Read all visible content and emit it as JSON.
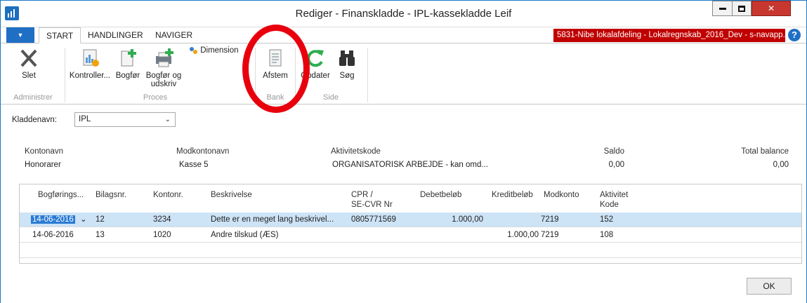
{
  "window": {
    "title": "Rediger - Finanskladde - IPL-kassekladde Leif"
  },
  "tabs": [
    {
      "label": "START"
    },
    {
      "label": "HANDLINGER"
    },
    {
      "label": "NAVIGER"
    }
  ],
  "company": "5831-Nibe lokalafdeling - Lokalregnskab_2016_Dev - s-navapp...",
  "help_label": "?",
  "ribbon": {
    "slet": "Slet",
    "kontroller": "Kontroller...",
    "bogfor": "Bogfør",
    "bogfor_udskriv_1": "Bogfør og",
    "bogfor_udskriv_2": "udskriv",
    "dimensioner": "Dimension",
    "afstem": "Afstem",
    "opdater": "Opdater",
    "sog": "Søg",
    "group_administrer": "Administrer",
    "group_proces": "Proces",
    "group_bank": "Bank",
    "group_side": "Side"
  },
  "kladde": {
    "label": "Kladdenavn:",
    "value": "IPL"
  },
  "info": {
    "kontonavn_label": "Kontonavn",
    "kontonavn_value": "Honorarer",
    "modkontonavn_label": "Modkontonavn",
    "modkontonavn_value": "Kasse 5",
    "aktivitetskode_label": "Aktivitetskode",
    "aktivitetskode_value": "ORGANISATORISK ARBEJDE - kan omd...",
    "saldo_label": "Saldo",
    "saldo_value": "0,00",
    "total_label": "Total balance",
    "total_value": "0,00"
  },
  "grid": {
    "headers": {
      "bogforing": "Bogførings...",
      "bilagsnr": "Bilagsnr.",
      "kontonr": "Kontonr.",
      "beskrivelse": "Beskrivelse",
      "cpr_1": "CPR /",
      "cpr_2": "SE-CVR Nr",
      "debet": "Debetbeløb",
      "kredit": "Kreditbeløb",
      "modkonto": "Modkonto",
      "aktivitet_1": "Aktivitet",
      "aktivitet_2": "Kode"
    },
    "rows": [
      {
        "date": "14-06-2016",
        "bilag": "12",
        "konto": "3234",
        "beskrivelse": "Dette er en meget lang beskrivel...",
        "cpr": "0805771569",
        "debet": "1.000,00",
        "kredit": "",
        "modkonto": "7219",
        "aktivitet": "152"
      },
      {
        "date": "14-06-2016",
        "bilag": "13",
        "konto": "1020",
        "beskrivelse": "Andre tilskud (ÆS)",
        "cpr": "",
        "debet": "",
        "kredit": "1.000,00",
        "modkonto": "7219",
        "aktivitet": "108"
      }
    ]
  },
  "ok_label": "OK",
  "colors": {
    "accent": "#1f6fc5",
    "company_bar": "#c00000",
    "selected_row": "#cde3f6",
    "annotation_circle": "#e8000d"
  }
}
